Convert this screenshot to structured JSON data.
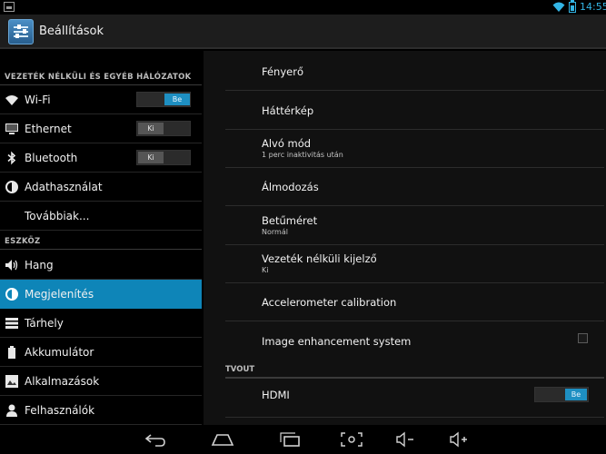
{
  "status_bar": {
    "time": "14:55",
    "icons": [
      "image-notification-icon",
      "wifi-icon",
      "battery-icon"
    ]
  },
  "action_bar": {
    "title": "Beállítások",
    "icon": "settings-app-icon"
  },
  "left_pane": {
    "sections": [
      {
        "header": "VEZETÉK NÉLKÜLI ÉS EGYÉB HÁLÓZATOK"
      },
      {
        "header": "ESZKÖZ"
      }
    ],
    "items": [
      {
        "label": "Wi-Fi",
        "icon": "wifi-icon",
        "toggle": "Be"
      },
      {
        "label": "Ethernet",
        "icon": "monitor-icon",
        "toggle": "Ki"
      },
      {
        "label": "Bluetooth",
        "icon": "bluetooth-icon",
        "toggle": "Ki"
      },
      {
        "label": "Adathasználat",
        "icon": "data-usage-icon"
      },
      {
        "label": "Továbbiak..."
      },
      {
        "label": "Hang",
        "icon": "speaker-icon"
      },
      {
        "label": "Megjelenítés",
        "icon": "brightness-icon",
        "selected": true
      },
      {
        "label": "Tárhely",
        "icon": "storage-icon"
      },
      {
        "label": "Akkumulátor",
        "icon": "battery-icon"
      },
      {
        "label": "Alkalmazások",
        "icon": "apps-icon"
      },
      {
        "label": "Felhasználók",
        "icon": "user-icon"
      }
    ]
  },
  "right_pane": {
    "items": [
      {
        "title": "Fényerő"
      },
      {
        "title": "Háttérkép"
      },
      {
        "title": "Alvó mód",
        "summary": "1 perc inaktivitás után"
      },
      {
        "title": "Álmodozás"
      },
      {
        "title": "Betűméret",
        "summary": "Normál"
      },
      {
        "title": "Vezeték nélküli kijelző",
        "summary": "Ki"
      },
      {
        "title": "Accelerometer calibration"
      },
      {
        "title": "Image enhancement system",
        "checked": false
      }
    ],
    "category": "TVOUT",
    "hdmi": {
      "title": "HDMI",
      "toggle": "Be"
    }
  },
  "nav_bar": {
    "buttons": [
      "back-icon",
      "home-icon",
      "recent-apps-icon",
      "screenshot-icon",
      "volume-down-icon",
      "volume-up-icon"
    ]
  },
  "colors": {
    "accent": "#33b5e5",
    "selected": "#0e85b8",
    "toggle_on": "#1e8fc2"
  }
}
